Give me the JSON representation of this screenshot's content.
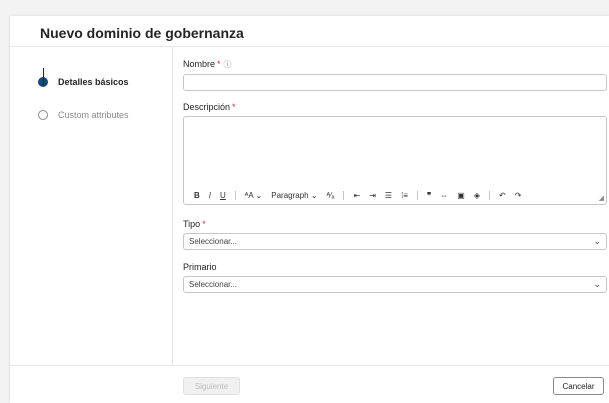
{
  "dialog": {
    "title": "Nuevo dominio de gobernanza"
  },
  "steps": [
    {
      "label": "Detalles básicos",
      "state": "active"
    },
    {
      "label": "Custom attributes",
      "state": "inactive"
    }
  ],
  "form": {
    "name": {
      "label": "Nombre",
      "required_mark": "*",
      "value": ""
    },
    "description": {
      "label": "Descripción",
      "required_mark": "*",
      "value": ""
    },
    "toolbar": {
      "bold": "B",
      "italic": "I",
      "underline": "U",
      "font_size": "AA",
      "paragraph": "Paragraph",
      "font_size_chevron": "⌄",
      "paragraph_chevron": "⌄"
    },
    "type": {
      "label": "Tipo",
      "required_mark": "*",
      "placeholder": "Seleccionar..."
    },
    "primary": {
      "label": "Primario",
      "placeholder": "Seleccionar..."
    }
  },
  "footer": {
    "next_label": "Siguiente",
    "cancel_label": "Cancelar"
  },
  "colors": {
    "accent": "#0f4c81",
    "required": "#c4314b",
    "border": "#c7c7c7"
  }
}
